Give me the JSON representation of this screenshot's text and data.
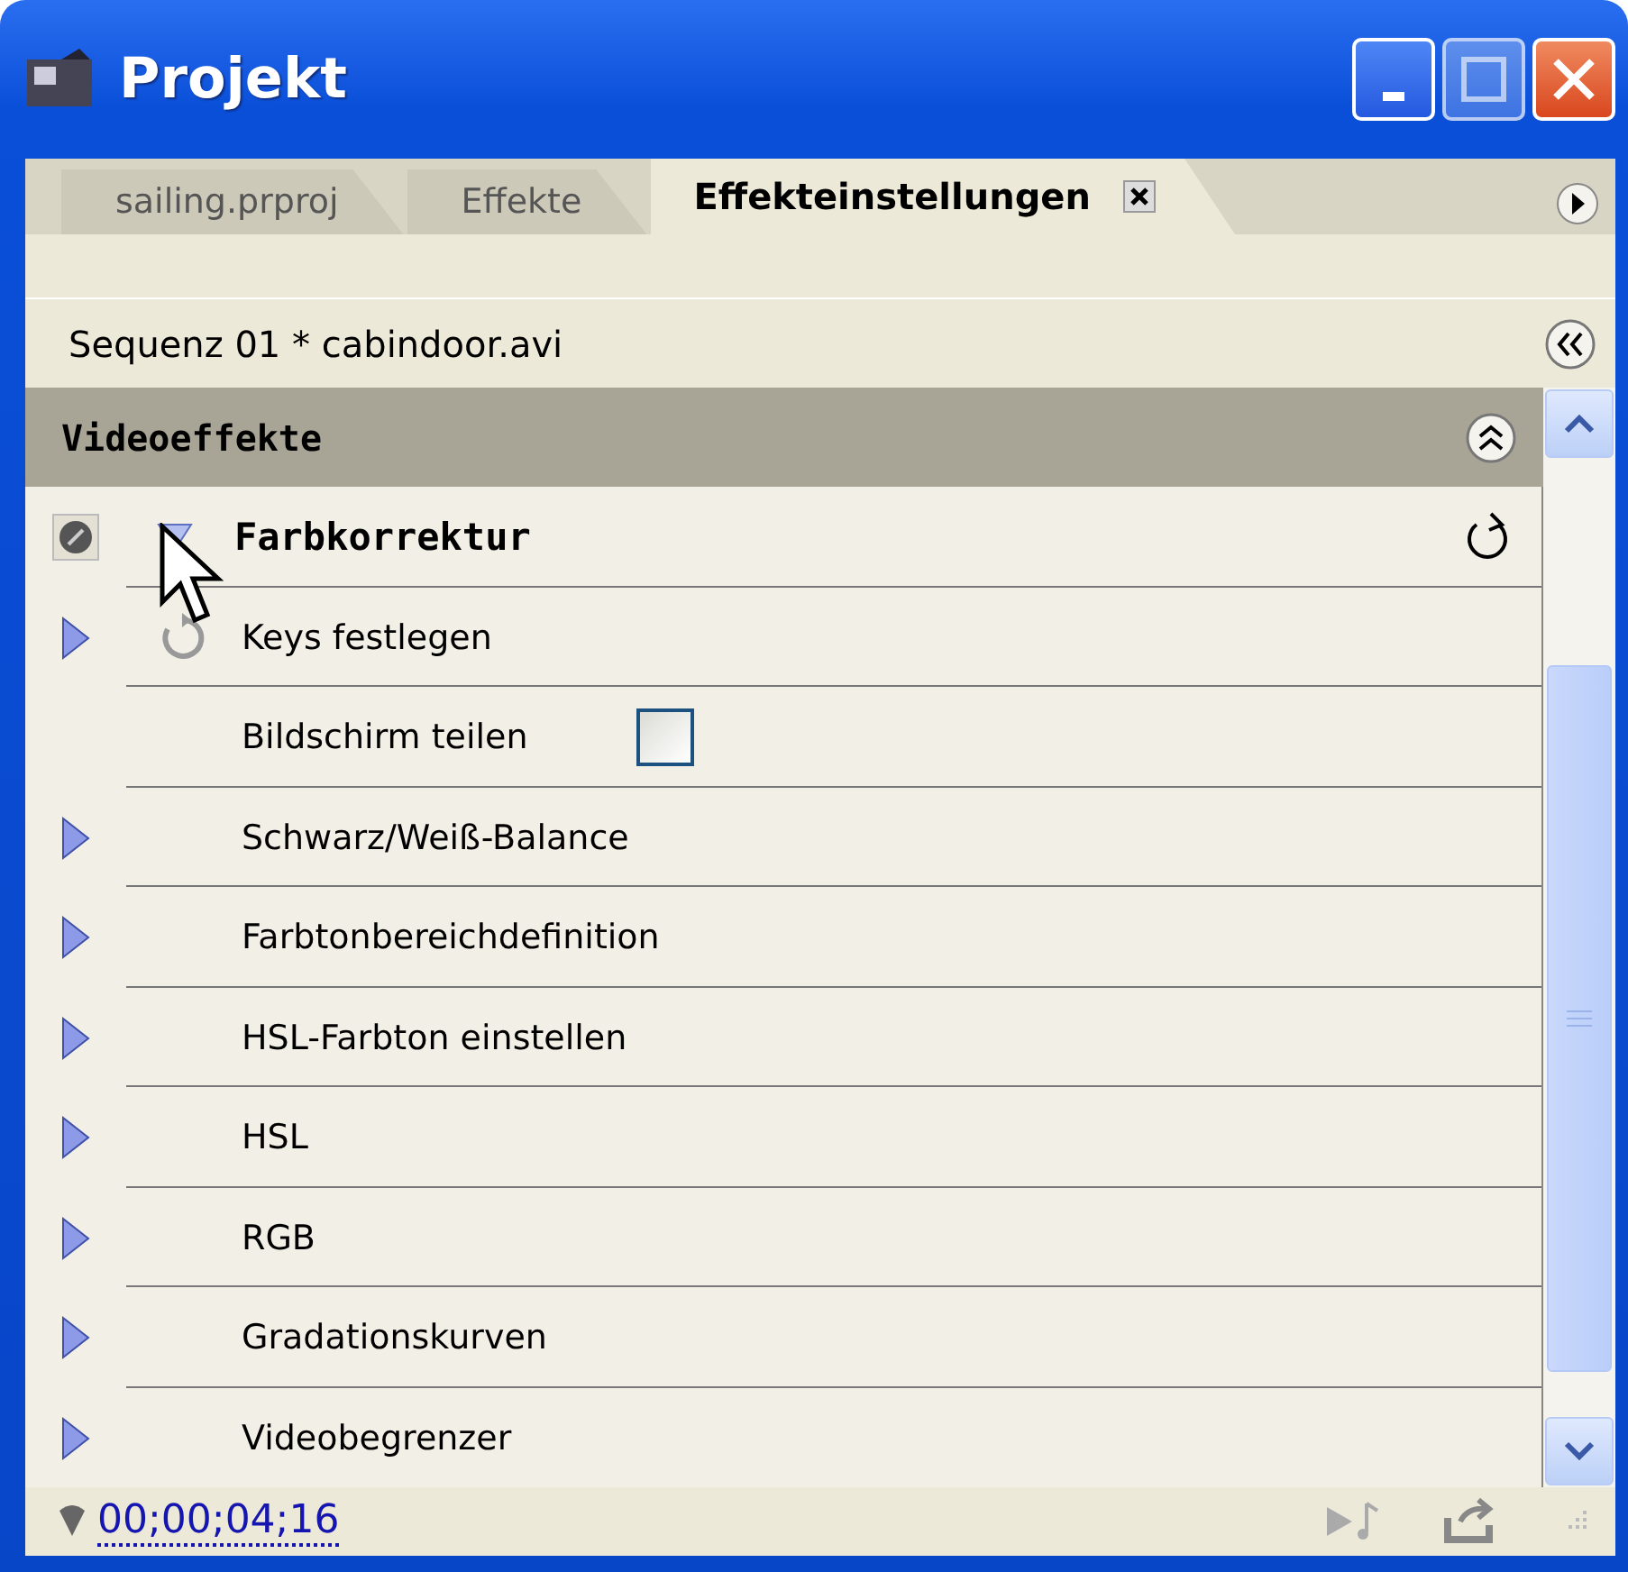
{
  "window": {
    "title": "Projekt"
  },
  "tabs": [
    {
      "label": "sailing.prproj",
      "selected": false
    },
    {
      "label": "Effekte",
      "selected": false
    },
    {
      "label": "Effekteinstellungen",
      "selected": true
    }
  ],
  "sequence": "Sequenz 01 * cabindoor.avi",
  "section": {
    "title": "Videoeffekte"
  },
  "effect": {
    "name": "Farbkorrektur",
    "expanded": true,
    "enabled": true
  },
  "properties": [
    {
      "kind": "keys",
      "label": "Keys festlegen",
      "expanded": false
    },
    {
      "kind": "checkbox",
      "label": "Bildschirm teilen",
      "checked": false
    },
    {
      "kind": "group",
      "label": "Schwarz/Weiß-Balance",
      "expanded": false
    },
    {
      "kind": "group",
      "label": "Farbtonbereichdefinition",
      "expanded": false
    },
    {
      "kind": "group",
      "label": "HSL-Farbton einstellen",
      "expanded": false
    },
    {
      "kind": "group",
      "label": "HSL",
      "expanded": false
    },
    {
      "kind": "group",
      "label": "RGB",
      "expanded": false
    },
    {
      "kind": "group",
      "label": "Gradationskurven",
      "expanded": false
    },
    {
      "kind": "group",
      "label": "Videobegrenzer",
      "expanded": false
    }
  ],
  "timecode": "00;00;04;16"
}
